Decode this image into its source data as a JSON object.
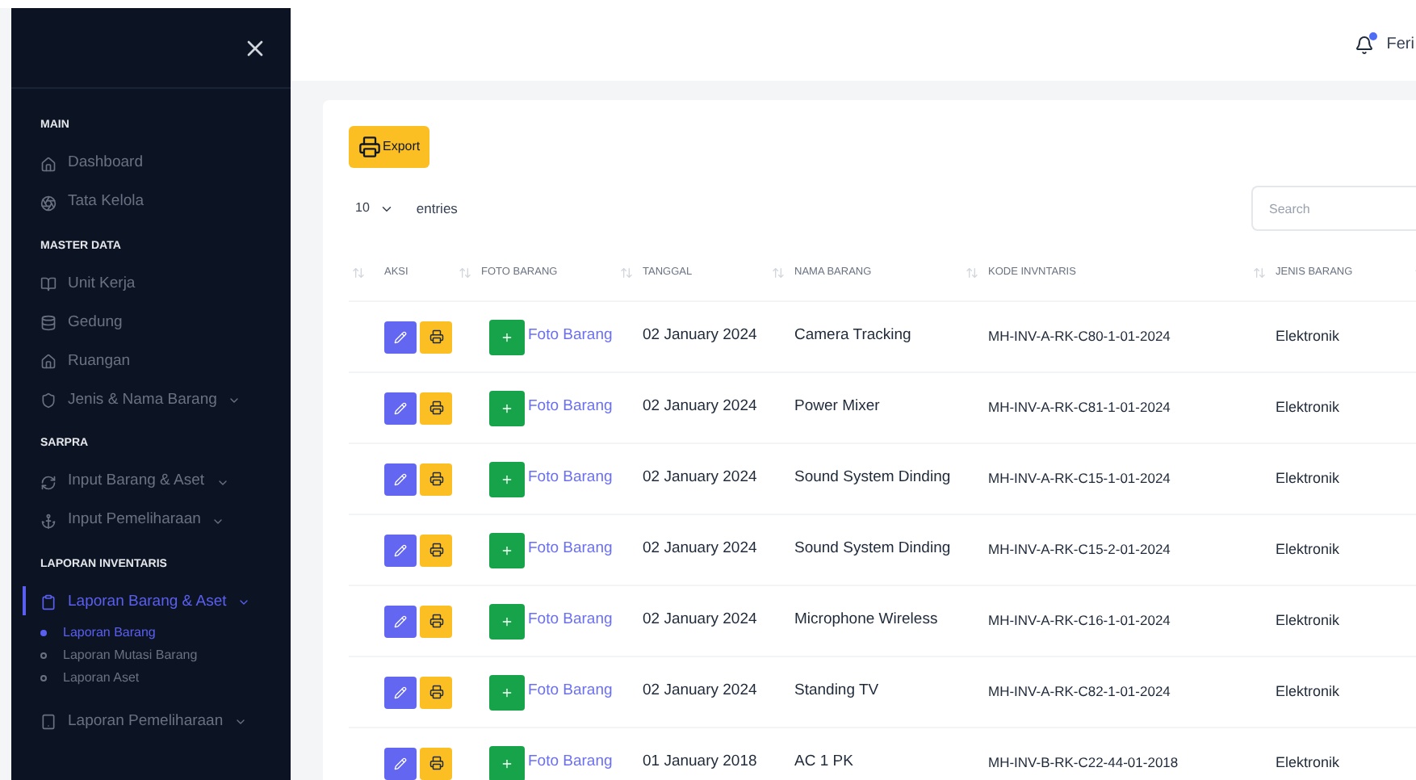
{
  "sidebar": {
    "sections": [
      {
        "title": "MAIN",
        "items": [
          {
            "label": "Dashboard",
            "kind": "link",
            "selected": false
          },
          {
            "label": "Tata Kelola",
            "kind": "link",
            "selected": false
          }
        ]
      },
      {
        "title": "MASTER DATA",
        "items": [
          {
            "label": "Unit Kerja",
            "kind": "link",
            "selected": false
          },
          {
            "label": "Gedung",
            "kind": "link",
            "selected": false
          },
          {
            "label": "Ruangan",
            "kind": "link",
            "selected": false
          },
          {
            "label": "Jenis & Nama Barang",
            "kind": "dropdown",
            "selected": false
          }
        ]
      },
      {
        "title": "SARPRA",
        "items": [
          {
            "label": "Input Barang & Aset",
            "kind": "dropdown",
            "selected": false
          },
          {
            "label": "Input Pemeliharaan",
            "kind": "dropdown",
            "selected": false
          }
        ]
      },
      {
        "title": "LAPORAN INVENTARIS",
        "items": [
          {
            "label": "Laporan Barang & Aset",
            "kind": "dropdown",
            "selected": true,
            "children": [
              {
                "label": "Laporan Barang",
                "selected": true
              },
              {
                "label": "Laporan Mutasi Barang",
                "selected": false
              },
              {
                "label": "Laporan Aset",
                "selected": false
              }
            ]
          },
          {
            "label": "Laporan Pemeliharaan",
            "kind": "dropdown",
            "selected": false
          }
        ]
      }
    ]
  },
  "header": {
    "user": "Feri",
    "has_notification": true
  },
  "toolbar": {
    "export": "Export",
    "page_size": "10",
    "entries_label": "entries",
    "search": {
      "placeholder": "Search"
    }
  },
  "table": {
    "columns": [
      "",
      "AKSI",
      "FOTO BARANG",
      "TANGGAL",
      "NAMA BARANG",
      "KODE INVNTARIS",
      "JENIS BARANG"
    ],
    "rows": [
      {
        "photo_link": "Foto Barang",
        "tanggal": "02 January 2024",
        "nama": "Camera Tracking",
        "kode": "MH-INV-A-RK-C80-1-01-2024",
        "jenis": "Elektronik"
      },
      {
        "photo_link": "Foto Barang",
        "tanggal": "02 January 2024",
        "nama": "Power Mixer",
        "kode": "MH-INV-A-RK-C81-1-01-2024",
        "jenis": "Elektronik"
      },
      {
        "photo_link": "Foto Barang",
        "tanggal": "02 January 2024",
        "nama": "Sound System Dinding",
        "kode": "MH-INV-A-RK-C15-1-01-2024",
        "jenis": "Elektronik"
      },
      {
        "photo_link": "Foto Barang",
        "tanggal": "02 January 2024",
        "nama": "Sound System Dinding",
        "kode": "MH-INV-A-RK-C15-2-01-2024",
        "jenis": "Elektronik"
      },
      {
        "photo_link": "Foto Barang",
        "tanggal": "02 January 2024",
        "nama": "Microphone Wireless",
        "kode": "MH-INV-A-RK-C16-1-01-2024",
        "jenis": "Elektronik"
      },
      {
        "photo_link": "Foto Barang",
        "tanggal": "02 January 2024",
        "nama": "Standing TV",
        "kode": "MH-INV-A-RK-C82-1-01-2024",
        "jenis": "Elektronik"
      },
      {
        "photo_link": "Foto Barang",
        "tanggal": "01 January 2018",
        "nama": "AC 1 PK",
        "kode": "MH-INV-B-RK-C22-44-01-2018",
        "jenis": "Elektronik"
      }
    ]
  }
}
